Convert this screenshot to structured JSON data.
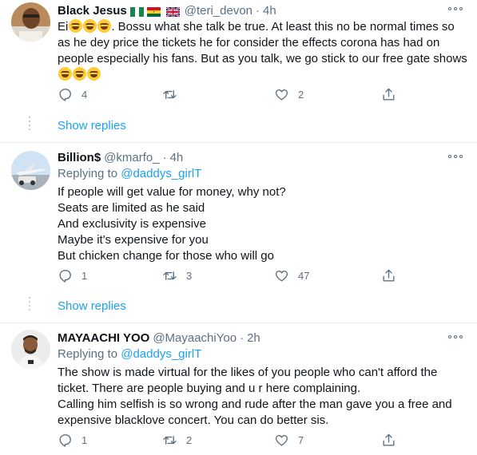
{
  "tweets": [
    {
      "name": "Black Jesus",
      "handle": "@teri_devon",
      "separator": "·",
      "time": "4h",
      "flags": [
        "nigeria",
        "ghana",
        "uk"
      ],
      "lines": [
        "Ei😂😂😂. Bossu what she talk be true. At least this no be normal times so",
        "as he dey price the tickets he for consider the effects corona has had on",
        "people especially his fans. But as you talk, we go stick to our free gate shows",
        "😂😂😂"
      ],
      "replies": "4",
      "retweets": "",
      "likes": "2",
      "show_replies": "Show replies"
    },
    {
      "name": "Billion$",
      "handle": "@kmarfo_",
      "separator": "·",
      "time": "4h",
      "replying_prefix": "Replying to",
      "replying_to": "@daddys_girlT",
      "lines": [
        "If people will get value for money, why not?",
        "Seats are limited as he said",
        "And exclusivity is expensive",
        "Maybe it's expensive for you",
        "But chicken change for those who will go"
      ],
      "replies": "1",
      "retweets": "3",
      "likes": "47",
      "show_replies": "Show replies"
    },
    {
      "name": "MAYAACHI YOO",
      "handle": "@MayaachiYoo",
      "separator": "·",
      "time": "2h",
      "replying_prefix": "Replying to",
      "replying_to": "@daddys_girlT",
      "lines": [
        "The show is made virtual for the likes of you people who can't afford the",
        "ticket. There are people buying and u r here complaining.",
        "Calling him selfish is so wrong and rude after the man gave you a free and",
        "expensive blacklove concert. You can do better sis."
      ],
      "replies": "1",
      "retweets": "2",
      "likes": "7"
    }
  ],
  "colors": {
    "accent": "#1da1f2",
    "muted": "#5b7083",
    "text": "#0f1419",
    "divider": "#e6ecf0"
  }
}
